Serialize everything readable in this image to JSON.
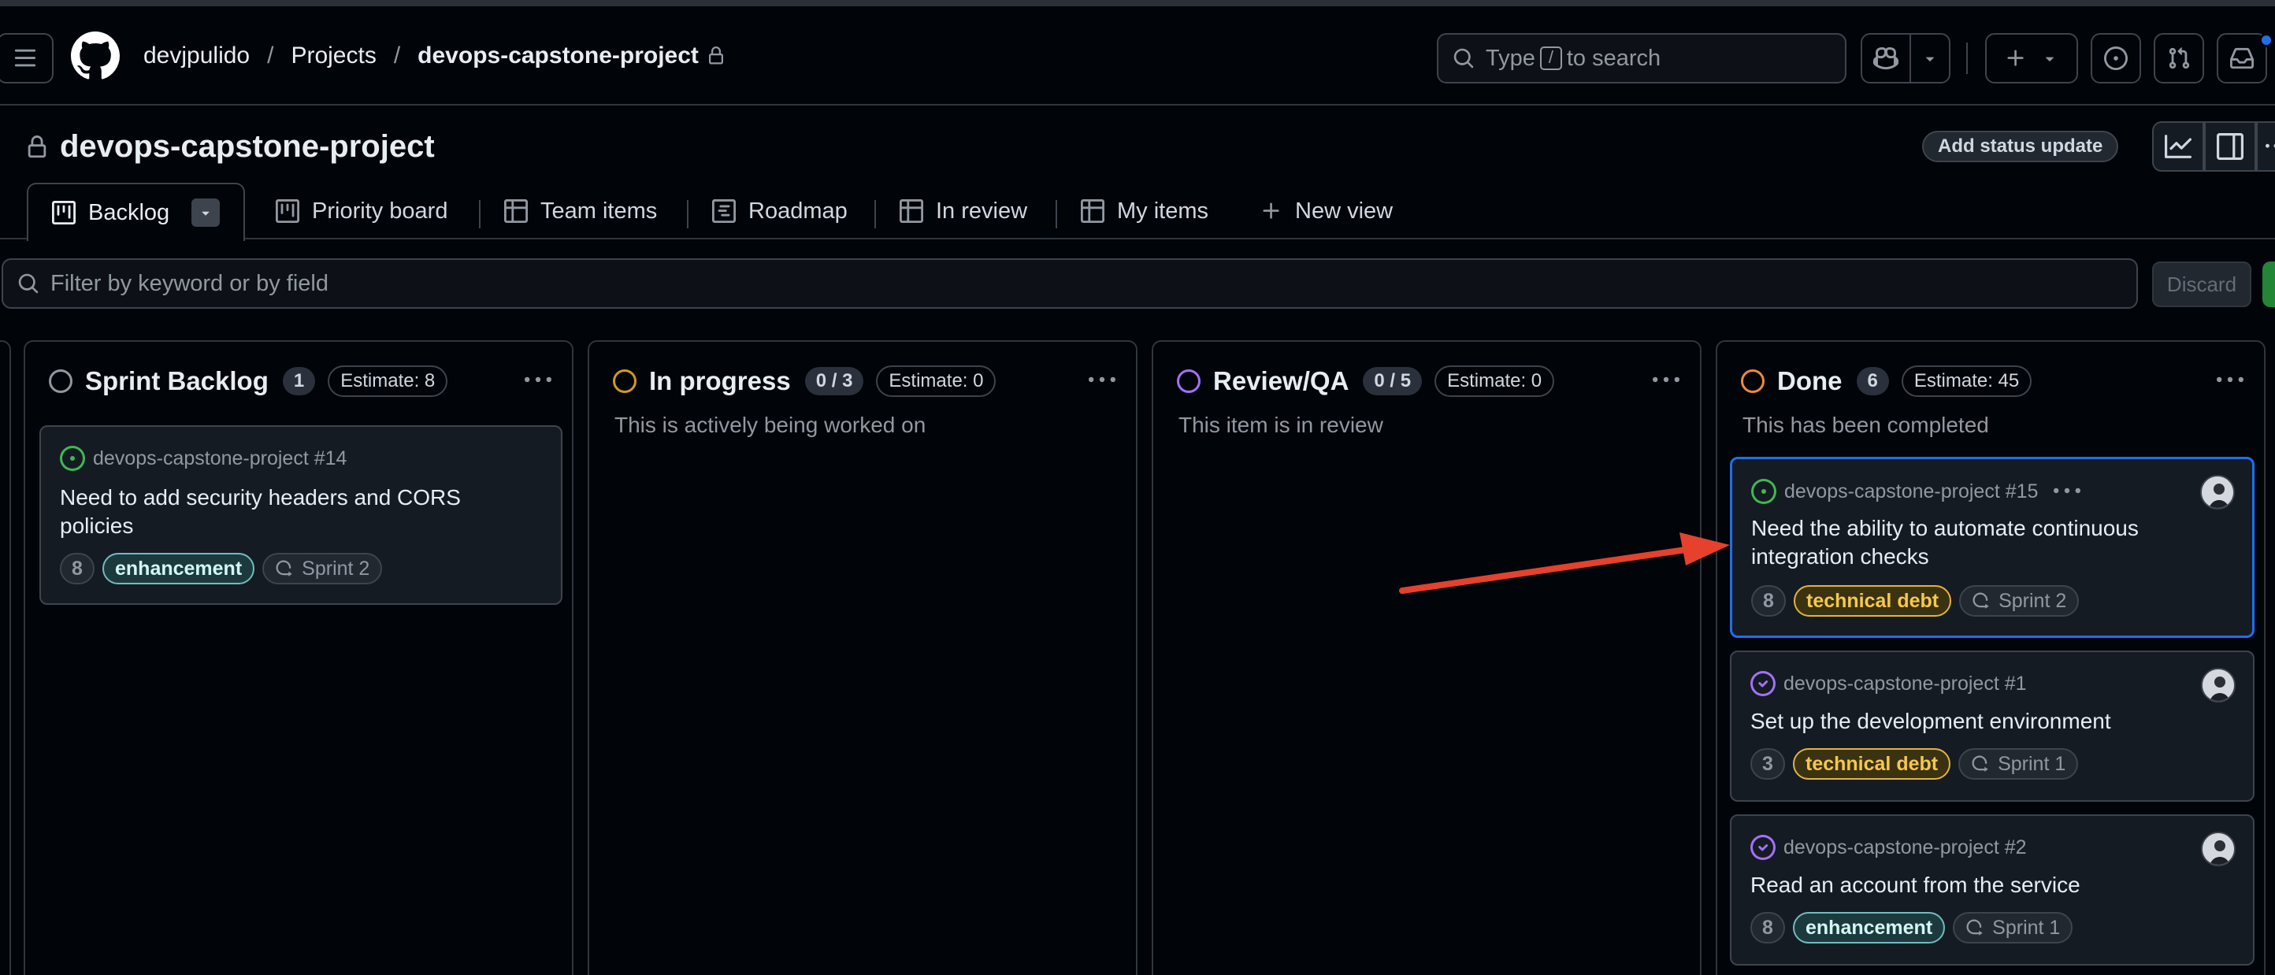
{
  "header": {
    "breadcrumbs": [
      "devjpulido",
      "Projects",
      "devops-capstone-project"
    ],
    "separator": "/",
    "search_pre": "Type",
    "search_key": "/",
    "search_post": "to search"
  },
  "project": {
    "title": "devops-capstone-project",
    "status_button": "Add status update"
  },
  "tabs": [
    {
      "label": "Backlog",
      "icon": "board-icon",
      "active": true
    },
    {
      "label": "Priority board",
      "icon": "board-icon"
    },
    {
      "label": "Team items",
      "icon": "table-icon"
    },
    {
      "label": "Roadmap",
      "icon": "roadmap-icon"
    },
    {
      "label": "In review",
      "icon": "table-icon"
    },
    {
      "label": "My items",
      "icon": "table-icon"
    },
    {
      "label": "New view",
      "icon": "plus-icon"
    }
  ],
  "filter": {
    "placeholder": "Filter by keyword or by field",
    "discard": "Discard"
  },
  "columns": [
    {
      "name": "Sprint Backlog",
      "count": "1",
      "estimate": "Estimate: 8",
      "description": "",
      "color": "#9198a1",
      "cards": [
        {
          "ref": "devops-capstone-project #14",
          "title_lines": [
            "Need to add security headers and CORS",
            "policies"
          ],
          "points": "8",
          "label": "enhancement",
          "sprint": "Sprint 2",
          "state": "open"
        }
      ]
    },
    {
      "name": "In progress",
      "count": "0 / 3",
      "estimate": "Estimate: 0",
      "description": "This is actively being worked on",
      "color": "#d29922",
      "cards": []
    },
    {
      "name": "Review/QA",
      "count": "0 / 5",
      "estimate": "Estimate: 0",
      "description": "This item is in review",
      "color": "#a371f7",
      "cards": []
    },
    {
      "name": "Done",
      "count": "6",
      "estimate": "Estimate: 45",
      "description": "This has been completed",
      "color": "#f0883e",
      "cards": [
        {
          "ref": "devops-capstone-project #15",
          "title_lines": [
            "Need the ability to automate continuous",
            "integration checks"
          ],
          "points": "8",
          "label": "technical debt",
          "sprint": "Sprint 2",
          "state": "open"
        },
        {
          "ref": "devops-capstone-project #1",
          "title_lines": [
            "Set up the development environment"
          ],
          "points": "3",
          "label": "technical debt",
          "sprint": "Sprint 1",
          "state": "closed"
        },
        {
          "ref": "devops-capstone-project #2",
          "title_lines": [
            "Read an account from the service"
          ],
          "points": "8",
          "label": "enhancement",
          "sprint": "Sprint 1",
          "state": "closed"
        }
      ]
    }
  ],
  "colors": {
    "accent": "#1f6feb",
    "open_issue": "#3fb950",
    "closed_issue": "#a371f7",
    "annotation_arrow": "#e5412d"
  }
}
